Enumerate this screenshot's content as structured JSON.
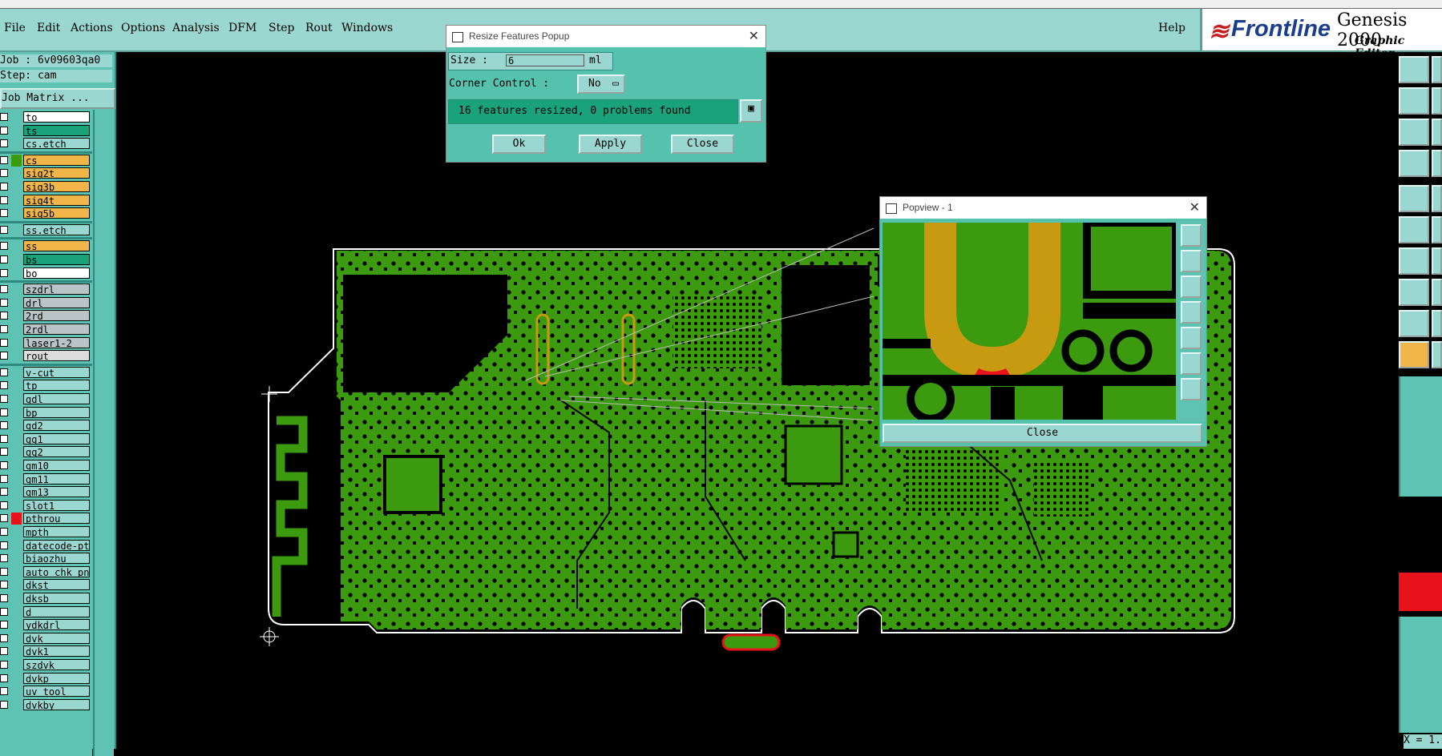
{
  "menubar": {
    "items": [
      "File",
      "Edit",
      "Actions",
      "Options",
      "Analysis",
      "DFM",
      "Step",
      "Rout",
      "Windows"
    ],
    "help": "Help"
  },
  "brand": {
    "name": "Frontline",
    "product": "Genesis 2000",
    "subtitle": "Graphic Editor",
    "colors": {
      "red": "#c81d1d",
      "blue": "#1a3e8c"
    }
  },
  "job": {
    "job_line": "Job : 6v09603qa0",
    "step_line": "Step: cam",
    "matrix_button": "Job Matrix ..."
  },
  "layers": [
    {
      "name": "to",
      "color": "#ffffff"
    },
    {
      "name": "ts",
      "color": "#1aa37a"
    },
    {
      "name": "cs.etch",
      "color": "#9bd7d1"
    },
    {
      "name": "cs",
      "color": "#f2b54a",
      "active": true
    },
    {
      "name": "sig2t",
      "color": "#f2b54a"
    },
    {
      "name": "sig3b",
      "color": "#f2b54a"
    },
    {
      "name": "sig4t",
      "color": "#f2b54a"
    },
    {
      "name": "sig5b",
      "color": "#f2b54a"
    },
    {
      "name": "ss.etch",
      "color": "#9bd7d1"
    },
    {
      "name": "ss",
      "color": "#f2b54a"
    },
    {
      "name": "bs",
      "color": "#1aa37a"
    },
    {
      "name": "bo",
      "color": "#ffffff"
    },
    {
      "name": "szdrl",
      "color": "#b9c4c6"
    },
    {
      "name": "drl",
      "color": "#b9c4c6"
    },
    {
      "name": "2rd",
      "color": "#b9c4c6"
    },
    {
      "name": "2rdl",
      "color": "#b9c4c6"
    },
    {
      "name": "laser1-2",
      "color": "#b9c4c6"
    },
    {
      "name": "rout",
      "color": "#dcdcdc"
    },
    {
      "name": "v-cut",
      "color": "#9bd7d1"
    },
    {
      "name": "tp",
      "color": "#9bd7d1"
    },
    {
      "name": "gdl",
      "color": "#9bd7d1"
    },
    {
      "name": "bp",
      "color": "#9bd7d1"
    },
    {
      "name": "gd2",
      "color": "#9bd7d1"
    },
    {
      "name": "gg1",
      "color": "#9bd7d1"
    },
    {
      "name": "gg2",
      "color": "#9bd7d1"
    },
    {
      "name": "gm10",
      "color": "#9bd7d1"
    },
    {
      "name": "gm11",
      "color": "#9bd7d1"
    },
    {
      "name": "gm13",
      "color": "#9bd7d1"
    },
    {
      "name": "slot1",
      "color": "#9bd7d1"
    },
    {
      "name": "pthrou",
      "color": "#9bd7d1",
      "work": true
    },
    {
      "name": "mpth",
      "color": "#9bd7d1"
    },
    {
      "name": "datecode-pte",
      "color": "#9bd7d1"
    },
    {
      "name": "biaozhu",
      "color": "#9bd7d1"
    },
    {
      "name": "auto_chk_pn.",
      "color": "#9bd7d1"
    },
    {
      "name": "dkst",
      "color": "#9bd7d1"
    },
    {
      "name": "dksb",
      "color": "#9bd7d1"
    },
    {
      "name": "d",
      "color": "#9bd7d1"
    },
    {
      "name": "ydkdrl",
      "color": "#9bd7d1"
    },
    {
      "name": "dvk",
      "color": "#9bd7d1"
    },
    {
      "name": "dvk1",
      "color": "#9bd7d1"
    },
    {
      "name": "szdvk",
      "color": "#9bd7d1"
    },
    {
      "name": "dvkp",
      "color": "#9bd7d1"
    },
    {
      "name": "uv_tool",
      "color": "#9bd7d1"
    },
    {
      "name": "dvkby",
      "color": "#9bd7d1"
    }
  ],
  "resize_popup": {
    "title": "Resize Features Popup",
    "size_label": "Size :",
    "size_value": "6",
    "size_unit": "ml",
    "corner_label": "Corner Control :",
    "corner_value": "No",
    "status": "16 features resized, 0 problems found",
    "ok": "Ok",
    "apply": "Apply",
    "close": "Close"
  },
  "popview": {
    "title": "Popview - 1",
    "close": "Close"
  },
  "coord_readout": "X = 1.",
  "colors": {
    "panel": "#5fc3b4",
    "panel_light": "#9bd7d1",
    "board_green": "#3c9a0e",
    "trace_gold": "#c89a12",
    "highlight_red": "#e8121a"
  }
}
